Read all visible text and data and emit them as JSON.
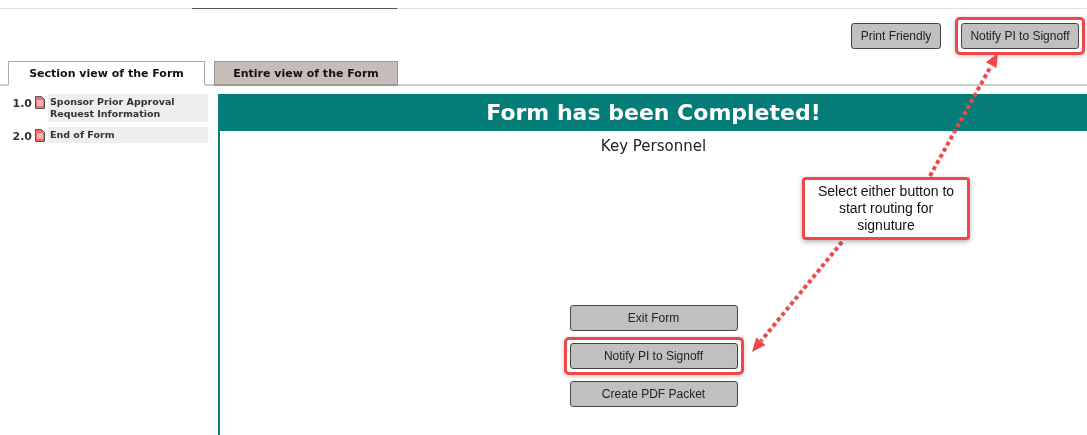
{
  "toolbar": {
    "buttons": [
      {
        "label": "Print Friendly",
        "highlighted": false
      },
      {
        "label": "Notify PI to Signoff",
        "highlighted": true
      }
    ]
  },
  "tabs": [
    {
      "label": "Section view of the Form",
      "selected": true
    },
    {
      "label": "Entire view of the Form",
      "selected": false
    }
  ],
  "sidebar": {
    "items": [
      {
        "number": "1.0",
        "label": "Sponsor Prior Approval Request Information"
      },
      {
        "number": "2.0",
        "label": "End of Form"
      }
    ]
  },
  "main": {
    "banner": "Form has been Completed!",
    "section_title": "Key Personnel",
    "buttons": [
      {
        "label": "Exit Form",
        "highlighted": false
      },
      {
        "label": "Notify PI to Signoff",
        "highlighted": true
      },
      {
        "label": "Create PDF Packet",
        "highlighted": false
      }
    ]
  },
  "callout": {
    "text": "Select either button to start routing for signuture"
  }
}
